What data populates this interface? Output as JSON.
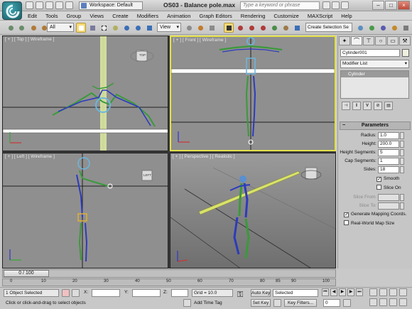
{
  "title_bar": {
    "workspace": "Workspace: Default",
    "document_title": "OS03 - Balance pole.max",
    "search_placeholder": "Type a keyword or phrase"
  },
  "menu": [
    "Edit",
    "Tools",
    "Group",
    "Views",
    "Create",
    "Modifiers",
    "Animation",
    "Graph Editors",
    "Rendering",
    "Customize",
    "MAXScript",
    "Help"
  ],
  "toolbar": {
    "selection_filter": "All",
    "reference_coord": "View",
    "named_selection_set": "Create Selection Se"
  },
  "viewports": {
    "top": "[ + ] [ Top ] [ Wireframe ]",
    "front": "[ + ] [ Front ] [ Wireframe ]",
    "left": "[ + ] [ Left ] [ Wireframe ]",
    "perspective": "[ + ] [ Perspective ] [ Realistic ]",
    "viewcube_top": "TOP",
    "viewcube_left": "LEFT"
  },
  "command_panel": {
    "object_name": "Cylinder001",
    "modifier_list": "Modifier List",
    "stack_item": "Cylinder",
    "rollout": "Parameters",
    "params": [
      {
        "label": "Radius:",
        "value": "1.0"
      },
      {
        "label": "Height:",
        "value": "200.0"
      },
      {
        "label": "Height Segments:",
        "value": "5"
      },
      {
        "label": "Cap Segments:",
        "value": "1"
      },
      {
        "label": "Sides:",
        "value": "18"
      }
    ],
    "smooth": "Smooth",
    "slice_on": "Slice On",
    "slice_from": "Slice From:",
    "slice_to": "Slice To:",
    "gen_mapping": "Generate Mapping Coords.",
    "real_world": "Real-World Map Size",
    "colors": {
      "accent_yellow": "#e3e14a",
      "viewport_grey": "#8f8f8f"
    }
  },
  "timeline": {
    "time_label": "0 / 100",
    "ticks": [
      "0",
      "10",
      "20",
      "30",
      "40",
      "50",
      "60",
      "70",
      "80",
      "85",
      "90",
      "100"
    ]
  },
  "status": {
    "selection": "1 Object Selected",
    "prompt": "Click or click-and-drag to select objects",
    "x_label": "X:",
    "y_label": "Y:",
    "z_label": "Z:",
    "grid": "Grid = 10.0",
    "add_time_tag": "Add Time Tag",
    "auto_key": "Auto Key",
    "set_key": "Set Key",
    "key_mode": "Selected",
    "key_filters": "Key Filters...",
    "frame": "0"
  }
}
